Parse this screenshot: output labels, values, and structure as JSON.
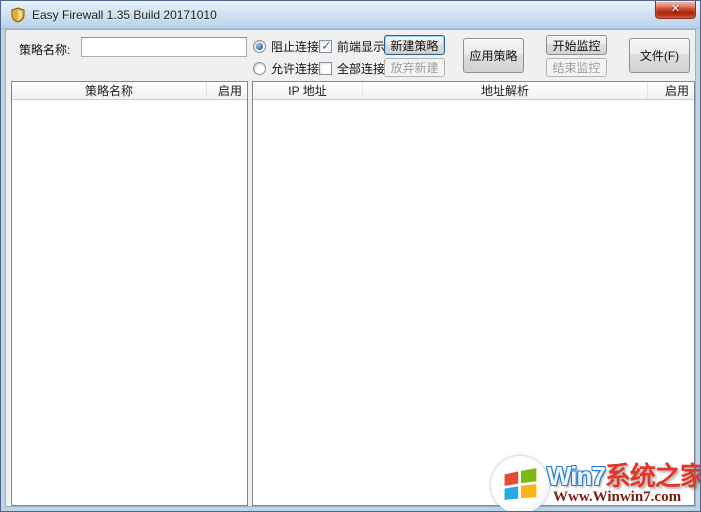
{
  "window": {
    "title": "Easy Firewall 1.35 Build 20171010",
    "close_glyph": "✕"
  },
  "toolbar": {
    "policy_name_label": "策略名称:",
    "policy_name_value": "",
    "radio_block_label": "阻止连接",
    "radio_allow_label": "允许连接",
    "check_front_label": "前端显示",
    "check_all_label": "全部连接",
    "new_policy_label": "新建策略",
    "discard_new_label": "放弃新建",
    "apply_policy_label": "应用策略",
    "start_monitor_label": "开始监控",
    "stop_monitor_label": "结束监控",
    "file_label": "文件(F)"
  },
  "policy_table": {
    "headers": {
      "name": "策略名称",
      "enabled": "启用"
    },
    "rows": []
  },
  "address_table": {
    "headers": {
      "ip": "IP 地址",
      "resolve": "地址解析",
      "enabled": "启用"
    },
    "rows": []
  },
  "watermark": {
    "brand_prefix": "Win7",
    "brand_suffix": "系统之家",
    "url": "Www.Winwin7.com"
  },
  "colors": {
    "titlebar_blue": "#cfe2f2",
    "close_red": "#cc4a2e",
    "client_gray": "#f0f0f0",
    "brand_blue": "#2a7fd0",
    "brand_red": "#e53528",
    "url_maroon": "#7a1d12",
    "flag_red": "#e14e31",
    "flag_green": "#7db916",
    "flag_blue": "#28a8e0",
    "flag_yellow": "#f8b517"
  }
}
